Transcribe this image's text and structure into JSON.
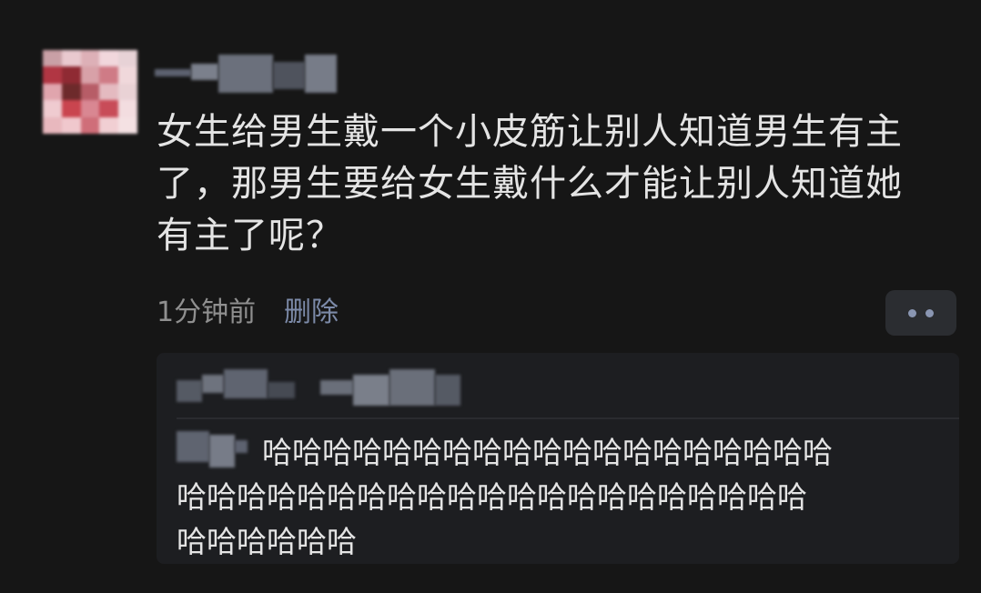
{
  "comment": {
    "lines": [
      "女生给男生戴一个小皮筋让别人知道男生有主",
      "了，那男生要给女生戴什么才能让别人知道她",
      "有主了呢？"
    ],
    "time": "1分钟前",
    "delete_label": "删除"
  },
  "reply": {
    "lines": [
      "哈哈哈哈哈哈哈哈哈哈哈哈哈哈哈哈哈哈哈",
      "哈哈哈哈哈哈哈哈哈哈哈哈哈哈哈哈哈哈哈哈哈",
      "哈哈哈哈哈哈"
    ]
  },
  "icons": {
    "more": "more-dots-icon"
  },
  "colors": {
    "background": "#161616",
    "reply_background": "#1d1e21",
    "text": "#e4e4e4",
    "muted": "#8f8f8f",
    "link": "#7c8aa8"
  }
}
